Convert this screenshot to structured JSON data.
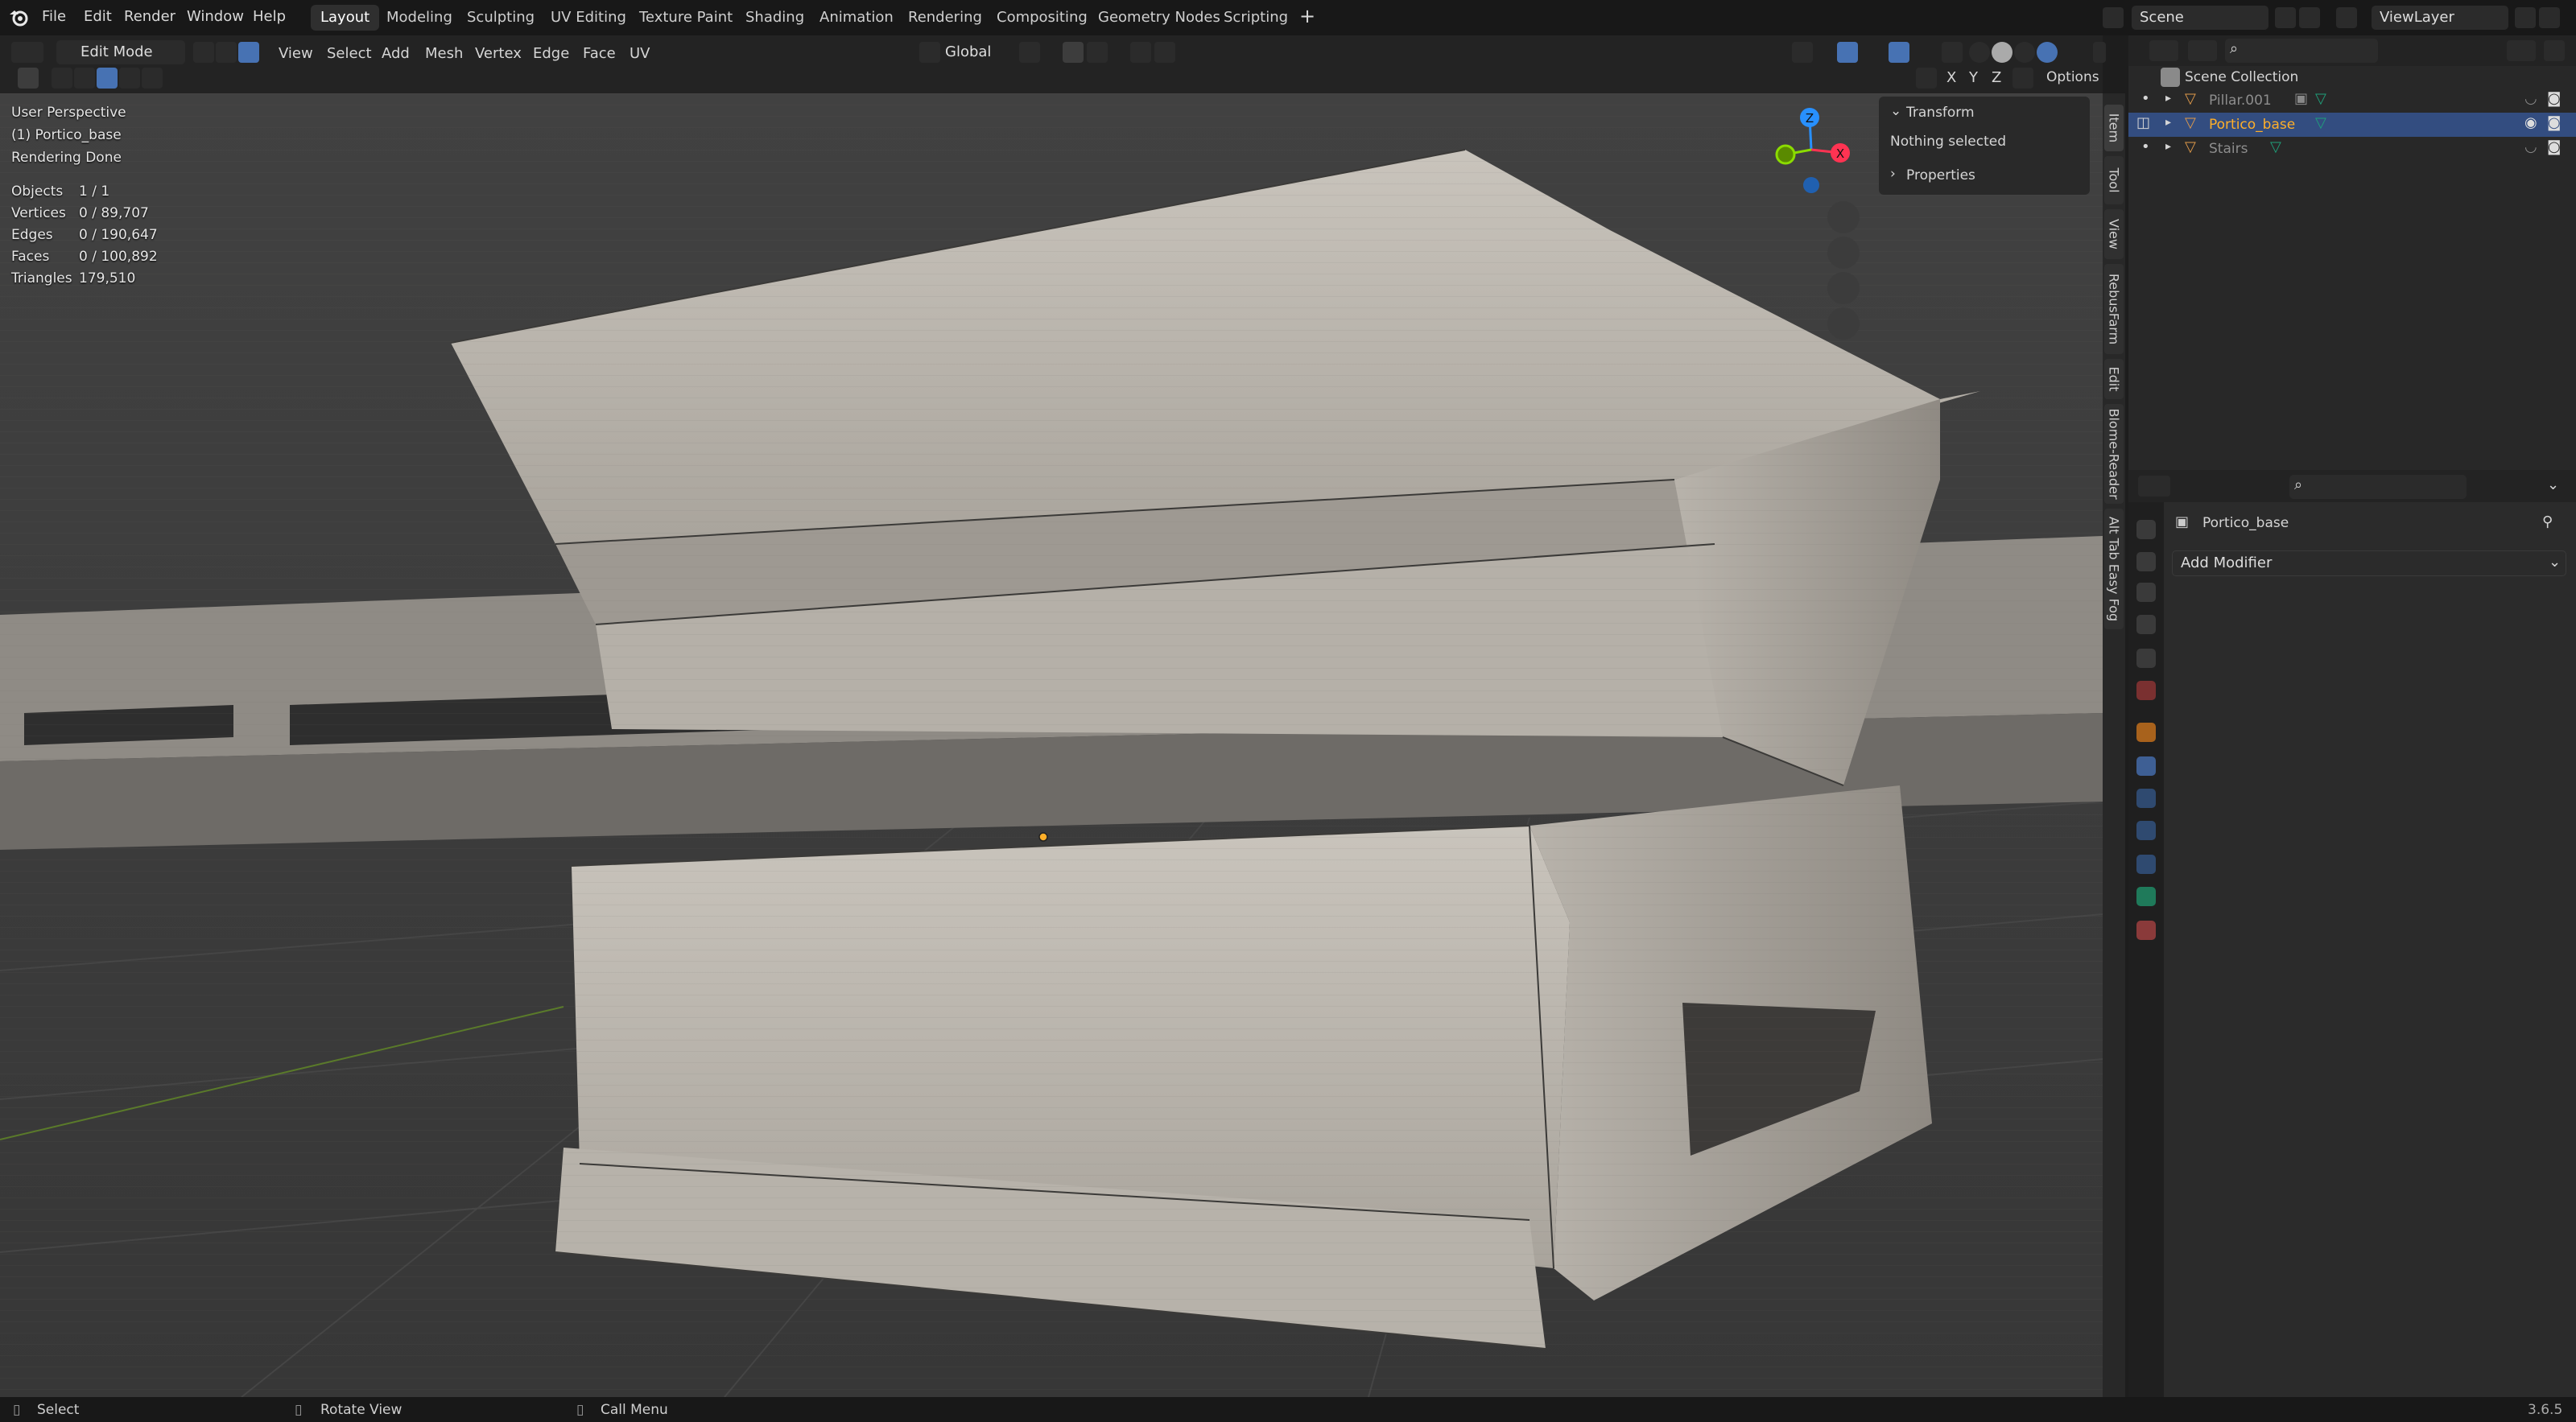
{
  "menu": {
    "items": [
      "File",
      "Edit",
      "Render",
      "Window",
      "Help"
    ]
  },
  "workspaces": [
    {
      "label": "Layout",
      "active": true
    },
    {
      "label": "Modeling"
    },
    {
      "label": "Sculpting"
    },
    {
      "label": "UV Editing"
    },
    {
      "label": "Texture Paint"
    },
    {
      "label": "Shading"
    },
    {
      "label": "Animation"
    },
    {
      "label": "Rendering"
    },
    {
      "label": "Compositing"
    },
    {
      "label": "Geometry Nodes"
    },
    {
      "label": "Scripting"
    }
  ],
  "scene": {
    "name": "Scene"
  },
  "viewlayer": {
    "name": "ViewLayer"
  },
  "viewport_header": {
    "mode": "Edit Mode",
    "menus": [
      "View",
      "Select",
      "Add",
      "Mesh",
      "Vertex",
      "Edge",
      "Face",
      "UV"
    ],
    "orientation": "Global",
    "options": "Options",
    "axes": [
      "X",
      "Y",
      "Z"
    ]
  },
  "overlay": {
    "perspective": "User Perspective",
    "object": "(1) Portico_base",
    "status": "Rendering Done",
    "stats": [
      {
        "label": "Objects",
        "value": "1 / 1"
      },
      {
        "label": "Vertices",
        "value": "0 / 89,707"
      },
      {
        "label": "Edges",
        "value": "0 / 190,647"
      },
      {
        "label": "Faces",
        "value": "0 / 100,892"
      },
      {
        "label": "Triangles",
        "value": "179,510"
      }
    ]
  },
  "npanel": {
    "transform": "Transform",
    "nothing": "Nothing selected",
    "properties": "Properties",
    "tabs": [
      "Item",
      "Tool",
      "View",
      "RebusFarm",
      "Edit",
      "Blome-Reader",
      "Alt Tab Easy Fog"
    ]
  },
  "gizmo": {
    "z": "Z",
    "x": "X"
  },
  "outliner": {
    "root": "Scene Collection",
    "items": [
      {
        "name": "Pillar.001",
        "selected": false
      },
      {
        "name": "Portico_base",
        "selected": true
      },
      {
        "name": "Stairs",
        "selected": false
      }
    ]
  },
  "properties": {
    "object": "Portico_base",
    "add_modifier": "Add Modifier"
  },
  "statusbar": {
    "select": "Select",
    "rotate": "Rotate View",
    "menu": "Call Menu",
    "version": "3.6.5"
  },
  "colors": {
    "accent": "#4772b3",
    "selected_row": "#334d80",
    "active_object": "#ffaf29",
    "axis_x": "#ff3352",
    "axis_y": "#8bdc00",
    "axis_z": "#2890ff"
  }
}
